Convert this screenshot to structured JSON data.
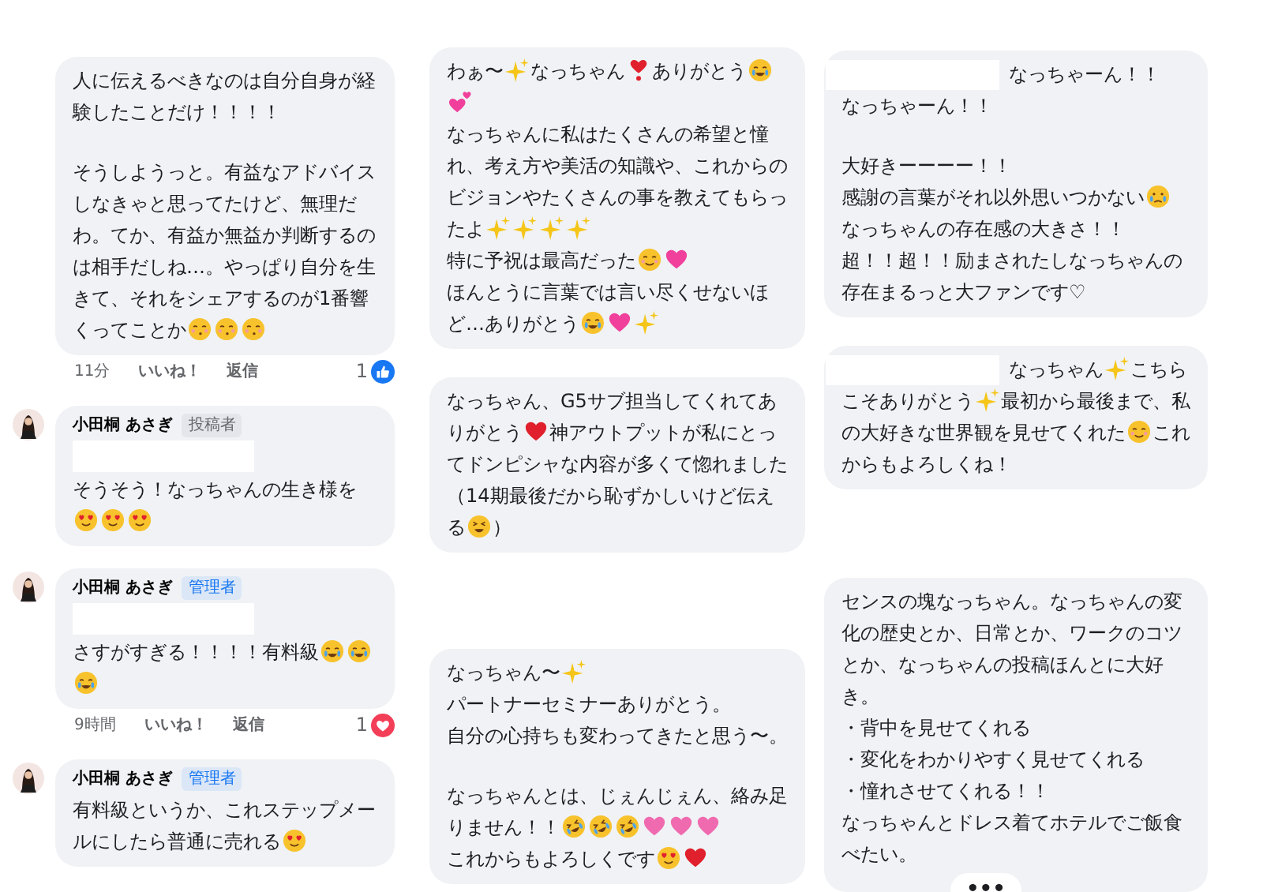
{
  "columns": [
    {
      "comments": [
        {
          "avatar": false,
          "sections": [
            {
              "paragraphs": [
                [
                  "人に伝えるべきなのは自分自身が経験したことだけ！！！！"
                ]
              ]
            },
            {
              "paragraphs": [
                [
                  "そうしようっと。有益なアドバイスしなきゃと思ってたけど、無理だわ。てか、有益か無益か判断するのは相手だしね…。やっぱり自分を生きて、それをシェアするのが1番響くってことか",
                  {
                    "kind": "blushing-face"
                  },
                  {
                    "kind": "blushing-face"
                  },
                  {
                    "kind": "blushing-face"
                  }
                ]
              ]
            }
          ],
          "meta": {
            "time": "11分",
            "like": "いいね！",
            "reply": "返信",
            "count": "1",
            "reaction": {
              "kind": "like"
            }
          }
        },
        {
          "avatar": true,
          "author": "小田桐 あさぎ",
          "badge": {
            "text": "投稿者",
            "kind": "author"
          },
          "redacted": true,
          "sections": [
            {
              "paragraphs": [
                [
                  "そうそう！なっちゃんの生き様を",
                  {
                    "kind": "heart-eyes-face"
                  },
                  {
                    "kind": "heart-eyes-face"
                  },
                  {
                    "kind": "heart-eyes-face"
                  }
                ]
              ]
            }
          ]
        },
        {
          "avatar": true,
          "author": "小田桐 あさぎ",
          "badge": {
            "text": "管理者",
            "kind": "admin"
          },
          "redacted": true,
          "sections": [
            {
              "paragraphs": [
                [
                  "さすがすぎる！！！！有料級",
                  {
                    "kind": "crying-face"
                  },
                  {
                    "kind": "crying-face"
                  },
                  {
                    "kind": "crying-face"
                  }
                ]
              ]
            }
          ],
          "meta": {
            "time": "9時間",
            "like": "いいね！",
            "reply": "返信",
            "count": "1",
            "reaction": {
              "kind": "love"
            }
          }
        },
        {
          "avatar": true,
          "author": "小田桐 あさぎ",
          "badge": {
            "text": "管理者",
            "kind": "admin"
          },
          "redacted": false,
          "sections": [
            {
              "paragraphs": [
                [
                  "有料級というか、これステップメールにしたら普通に売れる",
                  {
                    "kind": "heart-eyes-face"
                  }
                ]
              ]
            }
          ]
        }
      ]
    },
    {
      "comments": [
        {
          "sections": [
            {
              "paragraphs": [
                [
                  "わぁ〜",
                  {
                    "kind": "sparkles"
                  },
                  "なっちゃん",
                  {
                    "kind": "exclamation-heart"
                  },
                  "ありがとう",
                  {
                    "kind": "crying-face"
                  },
                  {
                    "kind": "two-hearts"
                  }
                ],
                [
                  "なっちゃんに私はたくさんの希望と憧れ、考え方や美活の知識や、これからのビジョンやたくさんの事を教えてもらったよ",
                  {
                    "kind": "sparkles"
                  },
                  {
                    "kind": "sparkles"
                  },
                  {
                    "kind": "sparkles"
                  },
                  {
                    "kind": "sparkles"
                  }
                ],
                [
                  "特に予祝は最高だった",
                  {
                    "kind": "relieved-face"
                  },
                  {
                    "kind": "sparkling-heart"
                  }
                ],
                [
                  "ほんとうに言葉では言い尽くせないほど…ありがとう",
                  {
                    "kind": "crying-face"
                  },
                  {
                    "kind": "sparkling-heart"
                  },
                  {
                    "kind": "sparkles"
                  }
                ]
              ]
            }
          ]
        },
        {
          "sections": [
            {
              "paragraphs": [
                [
                  "なっちゃん、G5サブ担当してくれてありがとう",
                  {
                    "kind": "red-heart"
                  },
                  "神アウトプットが私にとってドンピシャな内容が多くて惚れました（14期最後だから恥ずかしいけど伝える",
                  {
                    "kind": "laughing-face"
                  },
                  "）"
                ]
              ]
            }
          ]
        },
        {
          "sections": [
            {
              "paragraphs": [
                [
                  "なっちゃん〜",
                  {
                    "kind": "sparkles"
                  }
                ],
                [
                  "パートナーセミナーありがとう。"
                ],
                [
                  "自分の心持ちも変わってきたと思う〜。"
                ]
              ]
            },
            {
              "paragraphs": [
                [
                  "なっちゃんとは、じぇんじぇん、絡み足りません！！",
                  {
                    "kind": "rofl-face"
                  },
                  {
                    "kind": "rofl-face"
                  },
                  {
                    "kind": "rofl-face"
                  },
                  {
                    "kind": "pink-heart"
                  },
                  {
                    "kind": "pink-heart"
                  },
                  {
                    "kind": "pink-heart"
                  }
                ],
                [
                  "これからもよろしくです",
                  {
                    "kind": "heart-eyes-face"
                  },
                  {
                    "kind": "red-heart"
                  }
                ]
              ]
            }
          ]
        }
      ]
    },
    {
      "comments": [
        {
          "redacted_inline": true,
          "sections": [
            {
              "paragraphs": [
                [
                  "なっちゃーん！！"
                ],
                [
                  "なっちゃーん！！"
                ]
              ]
            },
            {
              "paragraphs": [
                [
                  "大好きーーーー！！"
                ],
                [
                  "感謝の言葉がそれ以外思いつかない",
                  {
                    "kind": "sad-face"
                  }
                ],
                [
                  "なっちゃんの存在感の大きさ！！"
                ],
                [
                  "超！！超！！励まされたしなっちゃんの存在まるっと大ファンです♡"
                ]
              ]
            }
          ]
        },
        {
          "redacted_inline": true,
          "sections": [
            {
              "paragraphs": [
                [
                  "なっちゃん",
                  {
                    "kind": "sparkles"
                  },
                  "こちらこそありがとう",
                  {
                    "kind": "sparkles"
                  },
                  "最初から最後まで、私の大好きな世界観を見せてくれた",
                  {
                    "kind": "smiling-face"
                  },
                  "これからもよろしくね！"
                ]
              ]
            }
          ]
        },
        {
          "more": "•••",
          "sections": [
            {
              "paragraphs": [
                [
                  "センスの塊なっちゃん。なっちゃんの変化の歴史とか、日常とか、ワークのコツとか、なっちゃんの投稿ほんとに大好き。"
                ],
                [
                  "・背中を見せてくれる"
                ],
                [
                  "・変化をわかりやすく見せてくれる"
                ],
                [
                  "・憧れさせてくれる！！"
                ],
                [
                  "なっちゃんとドレス着てホテルでご飯食べたい。"
                ]
              ]
            }
          ]
        }
      ]
    }
  ]
}
